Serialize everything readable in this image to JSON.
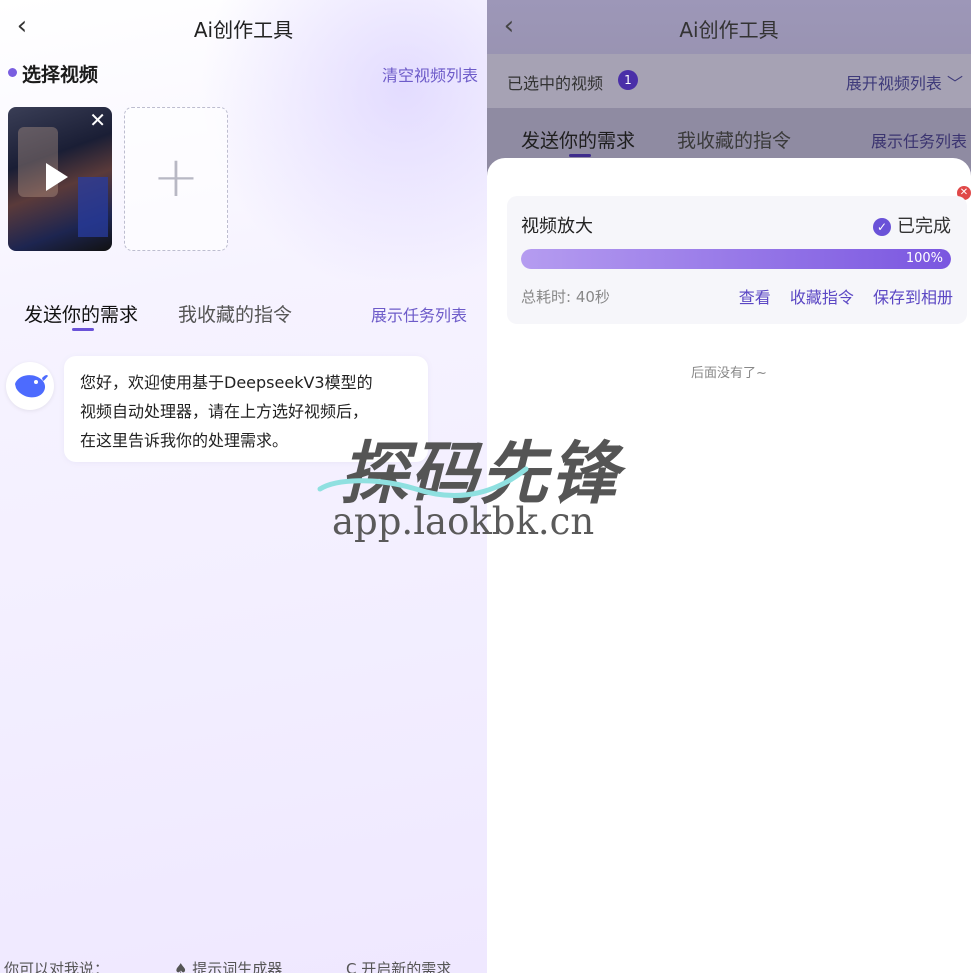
{
  "left": {
    "title": "Ai创作工具",
    "back_icon": "chevron-left-icon",
    "select_section": {
      "title": "选择视频",
      "clear_label": "清空视频列表"
    },
    "thumbnail": {
      "play_icon": "play-icon",
      "remove_icon": "close-icon"
    },
    "add_icon": "plus-icon",
    "tabs": [
      {
        "label": "发送你的需求",
        "active": true
      },
      {
        "label": "我收藏的指令",
        "active": false
      }
    ],
    "show_tasks_label": "展示任务列表",
    "bot_message": {
      "lines": [
        "您好，欢迎使用基于DeepseekV3模型的",
        "视频自动处理器，请在上方选好视频后，",
        "在这里告诉我你的处理需求。"
      ]
    },
    "bottom_hints": [
      "你可以对我说：",
      "♠ 提示词生成器",
      "C 开启新的需求"
    ]
  },
  "right": {
    "title": "Ai创作工具",
    "selected_label": "已选中的视频",
    "selected_count": "1",
    "expand_label": "展开视频列表 ﹀",
    "tabs": [
      {
        "label": "发送你的需求",
        "active": true
      },
      {
        "label": "我收藏的指令",
        "active": false
      }
    ],
    "show_tasks_label": "展示任务列表",
    "task": {
      "name": "视频放大",
      "status": "已完成",
      "progress_percent": 100,
      "progress_text": "100%",
      "elapsed": "总耗时: 40秒",
      "actions": [
        "查看",
        "收藏指令",
        "保存到相册"
      ]
    },
    "end_hint": "后面没有了~"
  },
  "watermark": {
    "text": "探码先锋",
    "url": "app.laokbk.cn"
  },
  "colors": {
    "accent": "#6a52d8",
    "link": "#6d5bc9",
    "overlay": "#8f8ba2"
  }
}
